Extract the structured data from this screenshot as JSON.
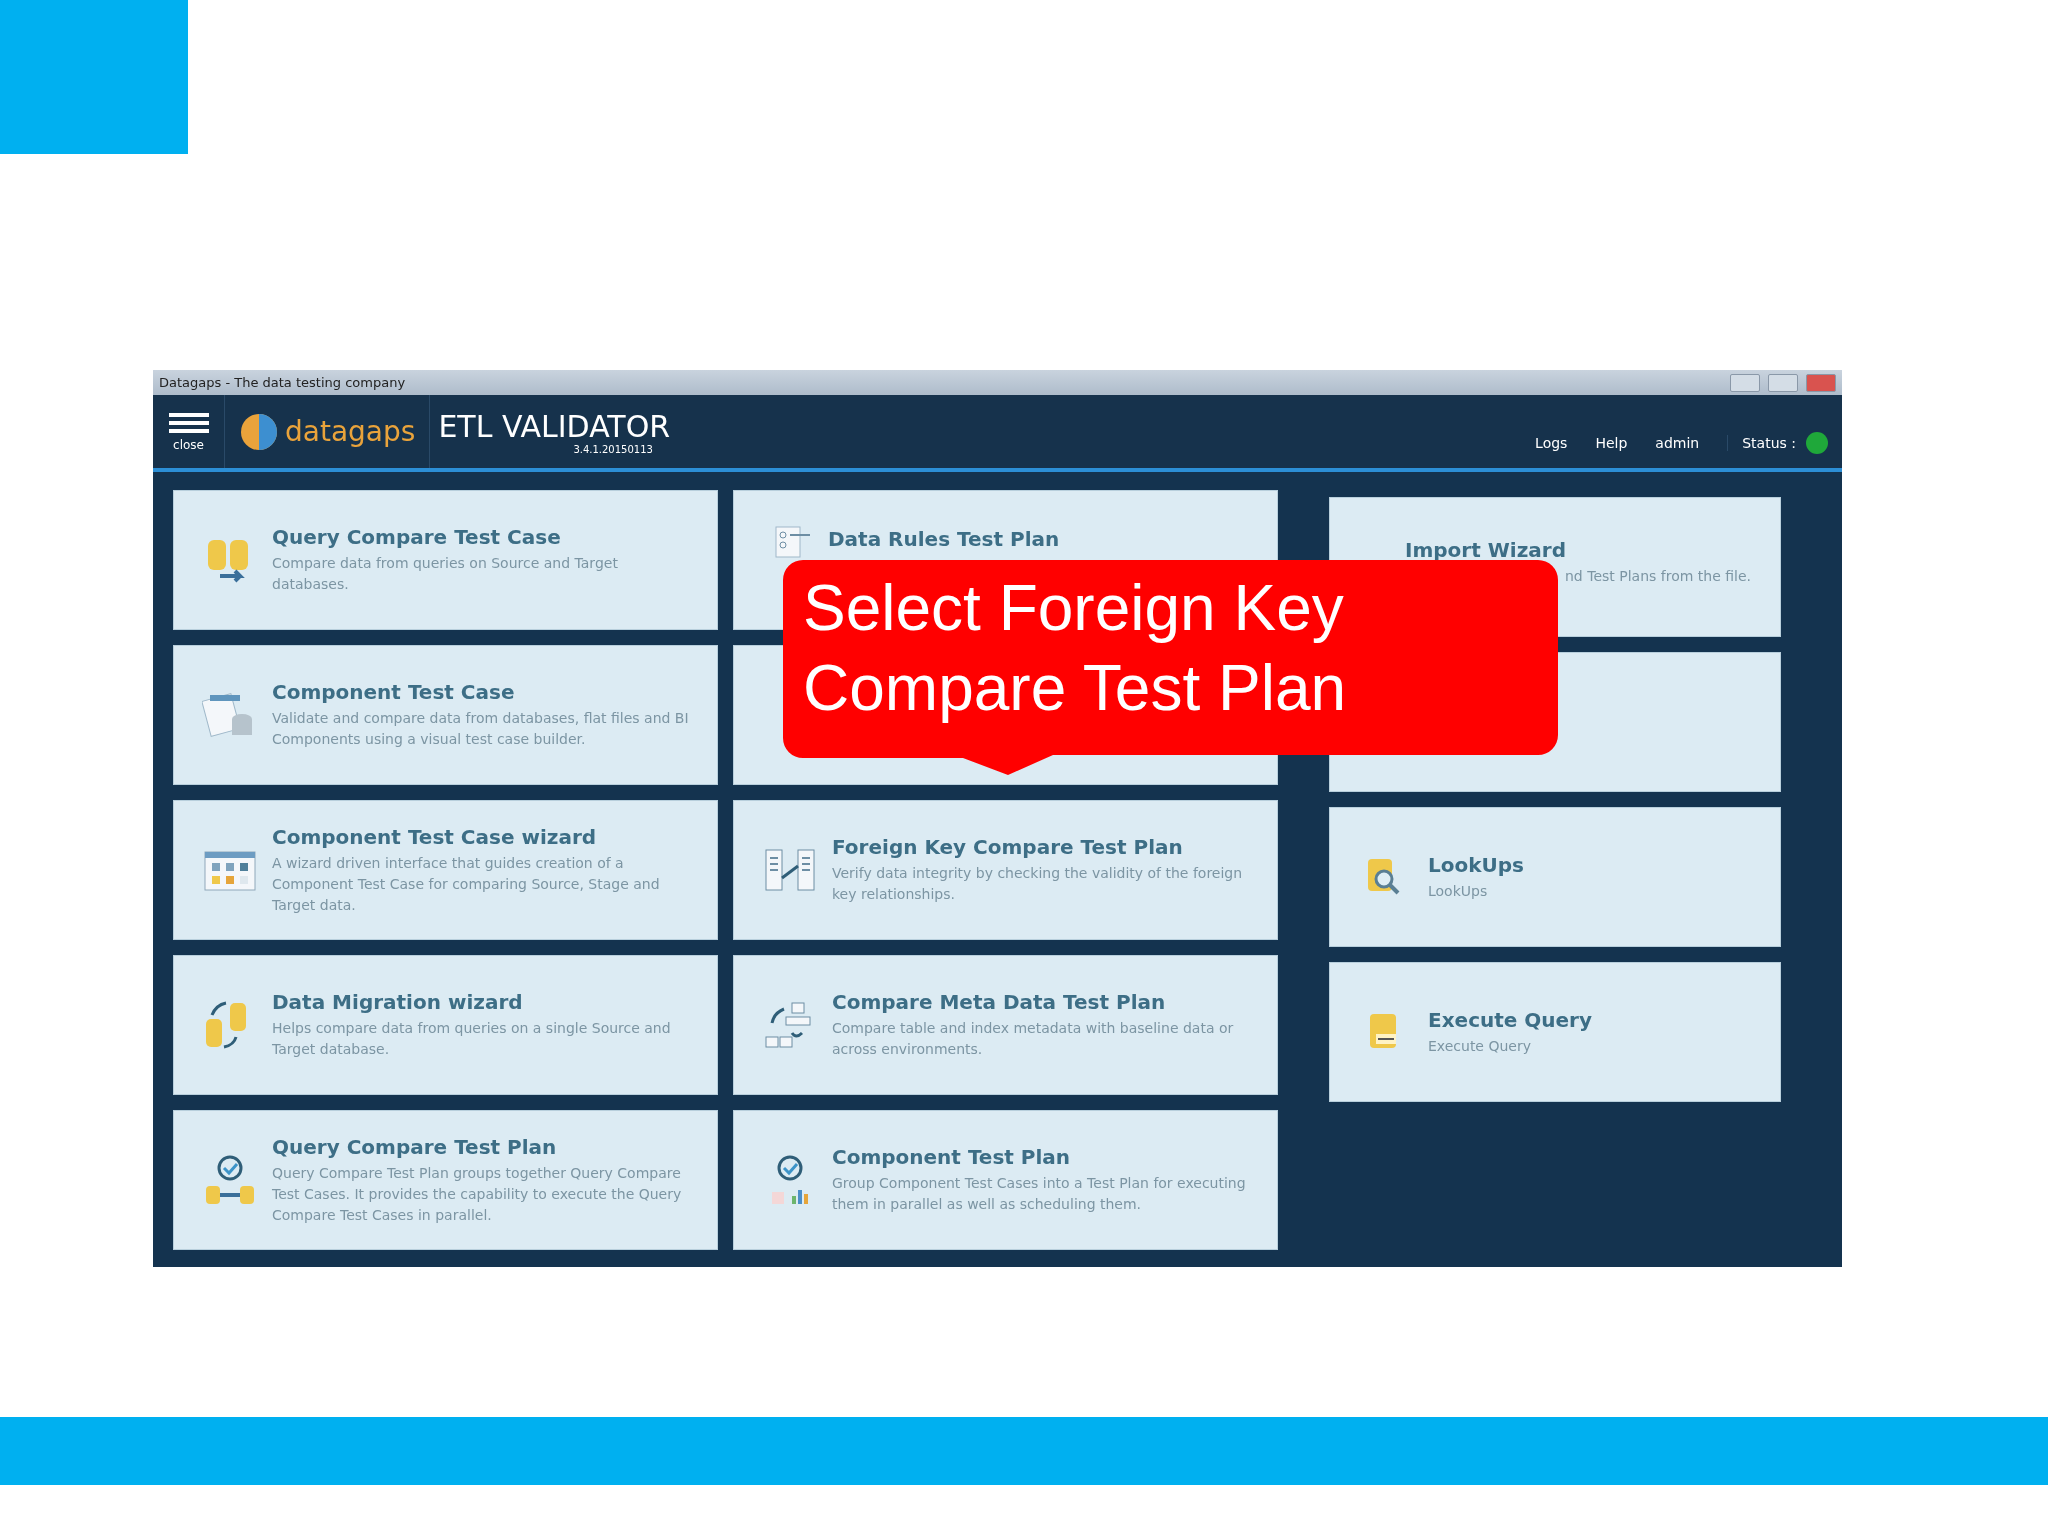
{
  "window": {
    "title": "Datagaps - The data testing company"
  },
  "header": {
    "menu_label": "close",
    "logo_text": "datagaps",
    "product": "ETL VALIDATOR",
    "version": "3.4.1.20150113",
    "links": [
      "Logs",
      "Help",
      "admin"
    ],
    "status_label": "Status :"
  },
  "columns": [
    {
      "cards": [
        {
          "kind": "tile",
          "title": "Query Compare Test Case",
          "description": "Compare data from queries on Source and Target databases."
        },
        {
          "kind": "tile",
          "title": "Component Test Case",
          "description": "Validate and compare data from databases, flat files and BI Components using a visual test case builder."
        },
        {
          "kind": "tile",
          "title": "Component Test Case wizard",
          "description": "A wizard driven interface that guides creation of a Component Test Case for comparing Source, Stage and Target data."
        },
        {
          "kind": "tile",
          "title": "Data Migration wizard",
          "description": "Helps compare data from queries on a single Source and Target database."
        },
        {
          "kind": "tile",
          "title": "Query Compare Test Plan",
          "description": "Query Compare Test Plan groups together Query Compare Test Cases. It provides the capability to execute the Query Compare Test Cases in parallel."
        }
      ]
    },
    {
      "cards": [
        {
          "kind": "partly-covered",
          "title": "Data Rules Test Plan"
        },
        {
          "kind": "empty"
        },
        {
          "kind": "tile",
          "title": "Foreign Key Compare Test Plan",
          "description": "Verify data integrity by checking the validity of the foreign key relationships."
        },
        {
          "kind": "tile",
          "title": "Compare Meta Data Test Plan",
          "description": "Compare table and index metadata with baseline data or across environments."
        },
        {
          "kind": "tile",
          "title": "Component Test Plan",
          "description": "Group Component Test Cases into a Test Plan for executing them in parallel as well as scheduling them."
        }
      ]
    },
    {
      "cards": [
        {
          "kind": "partly-covered",
          "title": "Import Wizard",
          "description": "nd Test Plans from the file."
        },
        {
          "kind": "empty"
        },
        {
          "kind": "tile",
          "title": "LookUps",
          "description": "LookUps"
        },
        {
          "kind": "tile",
          "title": "Execute Query",
          "description": "Execute Query"
        }
      ]
    }
  ],
  "callout": {
    "lines": [
      "Select Foreign Key",
      "Compare Test Plan"
    ]
  }
}
